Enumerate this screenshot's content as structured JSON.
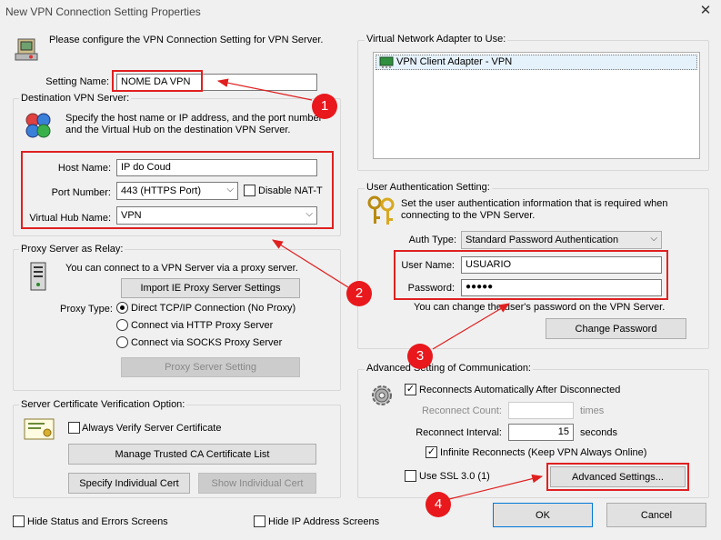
{
  "window": {
    "title": "New VPN Connection Setting Properties",
    "close": "✕"
  },
  "intro": {
    "text": "Please configure the VPN Connection Setting for VPN Server."
  },
  "setting_name": {
    "label": "Setting Name:",
    "value": "NOME DA VPN"
  },
  "destination": {
    "title": "Destination VPN Server:",
    "desc_line1": "Specify the host name or IP address, and the port number",
    "desc_line2": "and the Virtual Hub on the destination VPN Server.",
    "host_label": "Host Name:",
    "host_value": "IP do Coud",
    "port_label": "Port Number:",
    "port_value": "443 (HTTPS Port)",
    "disable_nat_label": "Disable NAT-T",
    "hub_label": "Virtual Hub Name:",
    "hub_value": "VPN"
  },
  "proxy": {
    "title": "Proxy Server as Relay:",
    "desc": "You can connect to a VPN Server via a proxy server.",
    "import_button": "Import IE Proxy Server Settings",
    "type_label": "Proxy Type:",
    "options": [
      "Direct TCP/IP Connection (No Proxy)",
      "Connect via HTTP Proxy Server",
      "Connect via SOCKS Proxy Server"
    ],
    "setting_button": "Proxy Server Setting"
  },
  "cert": {
    "title": "Server Certificate Verification Option:",
    "always_verify": "Always Verify Server Certificate",
    "manage_button": "Manage Trusted CA Certificate List",
    "specify_button": "Specify Individual Cert",
    "show_button": "Show Individual Cert"
  },
  "bottom": {
    "hide_status": "Hide Status and Errors Screens",
    "hide_ip": "Hide IP Address Screens",
    "ok": "OK",
    "cancel": "Cancel"
  },
  "adapter": {
    "title": "Virtual Network Adapter to Use:",
    "item": "VPN Client Adapter - VPN"
  },
  "auth": {
    "title": "User Authentication Setting:",
    "desc_line1": "Set the user authentication information that is required when",
    "desc_line2": "connecting to the VPN Server.",
    "type_label": "Auth Type:",
    "type_value": "Standard Password Authentication",
    "user_label": "User Name:",
    "user_value": "USUARIO",
    "pass_label": "Password:",
    "pass_value": "●●●●●",
    "change_hint": "You can change the user's password on the VPN Server.",
    "change_button": "Change Password"
  },
  "advanced": {
    "title": "Advanced Setting of Communication:",
    "reconnect_auto": "Reconnects Automatically After Disconnected",
    "reconnect_count_label": "Reconnect Count:",
    "reconnect_count_unit": "times",
    "reconnect_interval_label": "Reconnect Interval:",
    "reconnect_interval_value": "15",
    "reconnect_interval_unit": "seconds",
    "infinite": "Infinite Reconnects (Keep VPN Always Online)",
    "ssl3": "Use SSL 3.0 (1)",
    "advanced_button": "Advanced Settings..."
  },
  "badges": [
    "1",
    "2",
    "3",
    "4"
  ],
  "colors": {
    "annotation_red": "#e02020",
    "badge_red": "#e8181c",
    "selection": "#e5f1fb"
  },
  "icons": [
    "vpn-computer-icon",
    "network-globe-icon",
    "server-tower-icon",
    "certificate-icon",
    "keys-icon",
    "gear-icon",
    "network-adapter-icon"
  ]
}
